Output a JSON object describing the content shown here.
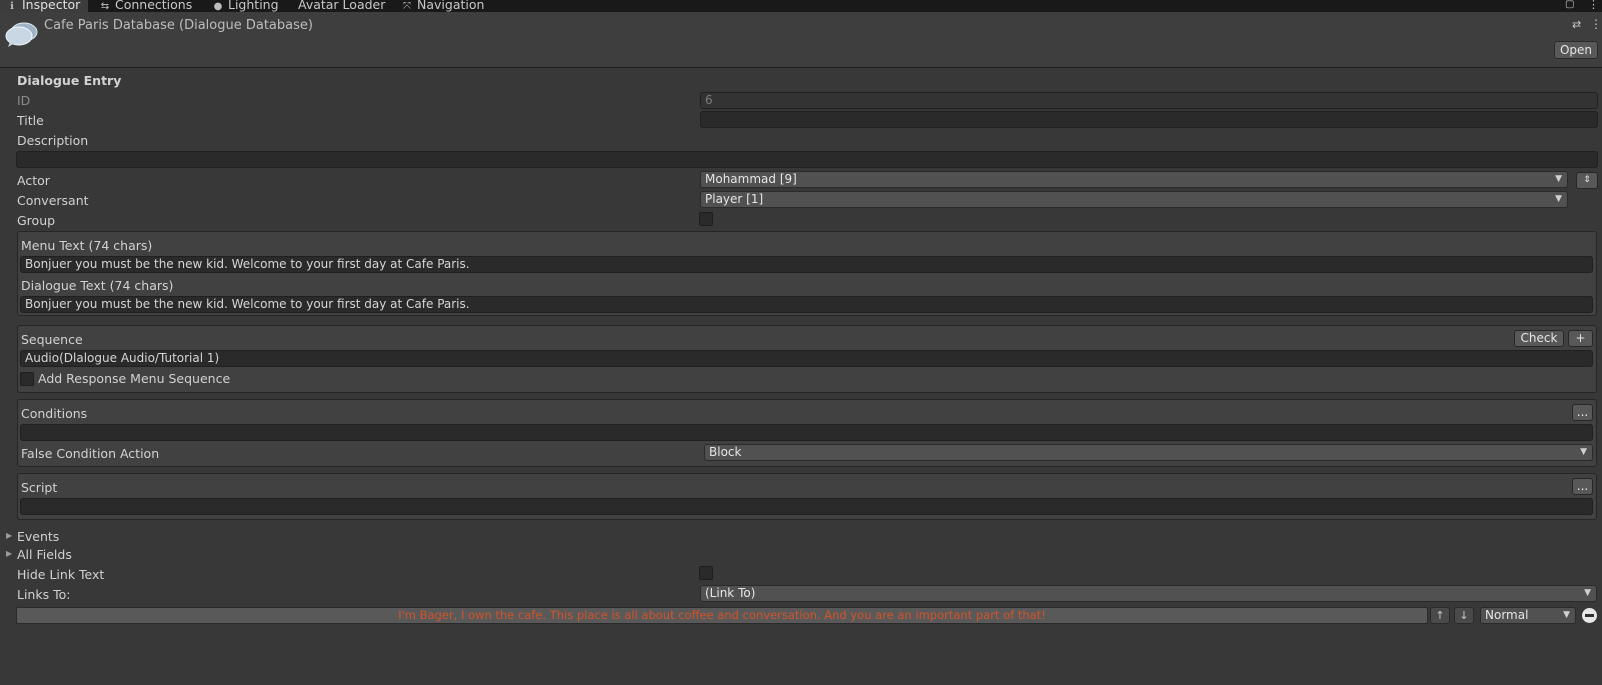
{
  "tabs": [
    {
      "label": "Inspector",
      "icon": "info-icon"
    },
    {
      "label": "Connections",
      "icon": "connections-icon"
    },
    {
      "label": "Lighting",
      "icon": "lightbulb-icon"
    },
    {
      "label": "Avatar Loader",
      "icon": ""
    },
    {
      "label": "Navigation",
      "icon": "navigation-icon"
    }
  ],
  "header": {
    "title": "Cafe Paris Database (Dialogue Database)",
    "open_label": "Open",
    "icon": "dialogue-database-icon"
  },
  "entry": {
    "section_title": "Dialogue Entry",
    "id_label": "ID",
    "id_value": "6",
    "title_label": "Title",
    "title_value": "",
    "description_label": "Description",
    "description_value": "",
    "actor_label": "Actor",
    "actor_value": "Mohammad [9]",
    "conversant_label": "Conversant",
    "conversant_value": "Player [1]",
    "group_label": "Group",
    "group_checked": false
  },
  "text": {
    "menu_label": "Menu Text (74 chars)",
    "menu_value": "Bonjuer you must be the new kid. Welcome to your first day at Cafe Paris.",
    "dialogue_label": "Dialogue Text (74 chars)",
    "dialogue_value": "Bonjuer you must be the new kid. Welcome to your first day at Cafe Paris."
  },
  "sequence": {
    "label": "Sequence",
    "check_label": "Check",
    "add_label": "+",
    "value": "Audio(Dlalogue Audio/Tutorial 1)",
    "response_label": "Add Response Menu Sequence",
    "response_checked": false
  },
  "conditions": {
    "label": "Conditions",
    "more_label": "...",
    "value": "",
    "false_action_label": "False Condition Action",
    "false_action_value": "Block"
  },
  "script": {
    "label": "Script",
    "more_label": "...",
    "value": ""
  },
  "foldouts": {
    "events_label": "Events",
    "all_fields_label": "All Fields"
  },
  "links": {
    "hide_link_text_label": "Hide Link Text",
    "hide_link_text_checked": false,
    "links_to_label": "Links To:",
    "links_to_value": "(Link To)",
    "link_text": "I'm Bager, I own the cafe. This place is all about coffee and conversation. And you are an important part of that!",
    "priority_value": "Normal",
    "link_text_color": "#d2542a"
  }
}
